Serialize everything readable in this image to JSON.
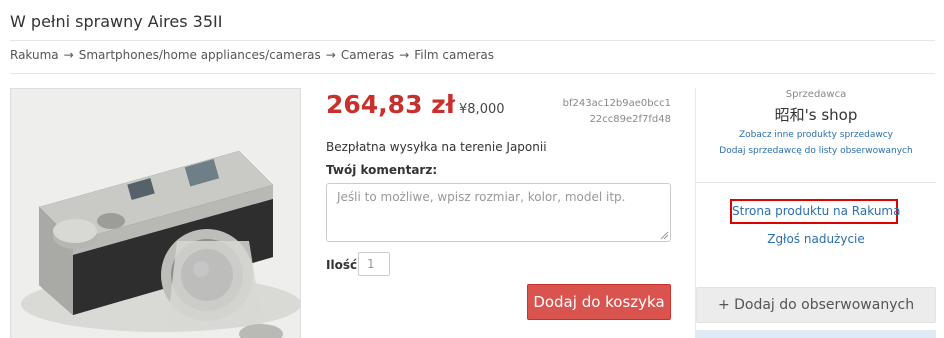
{
  "page": {
    "title": "W pełni sprawny Aires 35II"
  },
  "breadcrumb": {
    "items": [
      "Rakuma",
      "Smartphones/home appliances/cameras",
      "Cameras",
      "Film cameras"
    ],
    "separator": "→"
  },
  "product": {
    "price_pln": "264,83 zł",
    "price_yen": "¥8,000",
    "item_id_line1": "bf243ac12b9ae0bcc1",
    "item_id_line2": "22cc89e2f7fd48",
    "shipping": "Bezpłatna wysyłka na terenie Japonii",
    "comment_label": "Twój komentarz:",
    "comment_placeholder": "Jeśli to możliwe, wpisz rozmiar, kolor, model itp.",
    "quantity_label": "Ilość:",
    "quantity_value": "1",
    "add_to_cart": "Dodaj do koszyka",
    "image_alt": "Aires 35II camera"
  },
  "seller": {
    "label": "Sprzedawca",
    "name": "昭和's shop",
    "other_products": "Zobacz inne produkty sprzedawcy",
    "watch_seller": "Dodaj sprzedawcę do listy obserwowanych"
  },
  "sidebar": {
    "rakuma_link": "Strona produktu na Rakuma",
    "report_link": "Zgłoś nadużycie",
    "watch_button": "+ Dodaj do obserwowanych"
  },
  "colors": {
    "price": "#c9302c",
    "cart_button": "#d9534f",
    "link": "#2a6fb3",
    "highlight_border": "#e10000"
  }
}
